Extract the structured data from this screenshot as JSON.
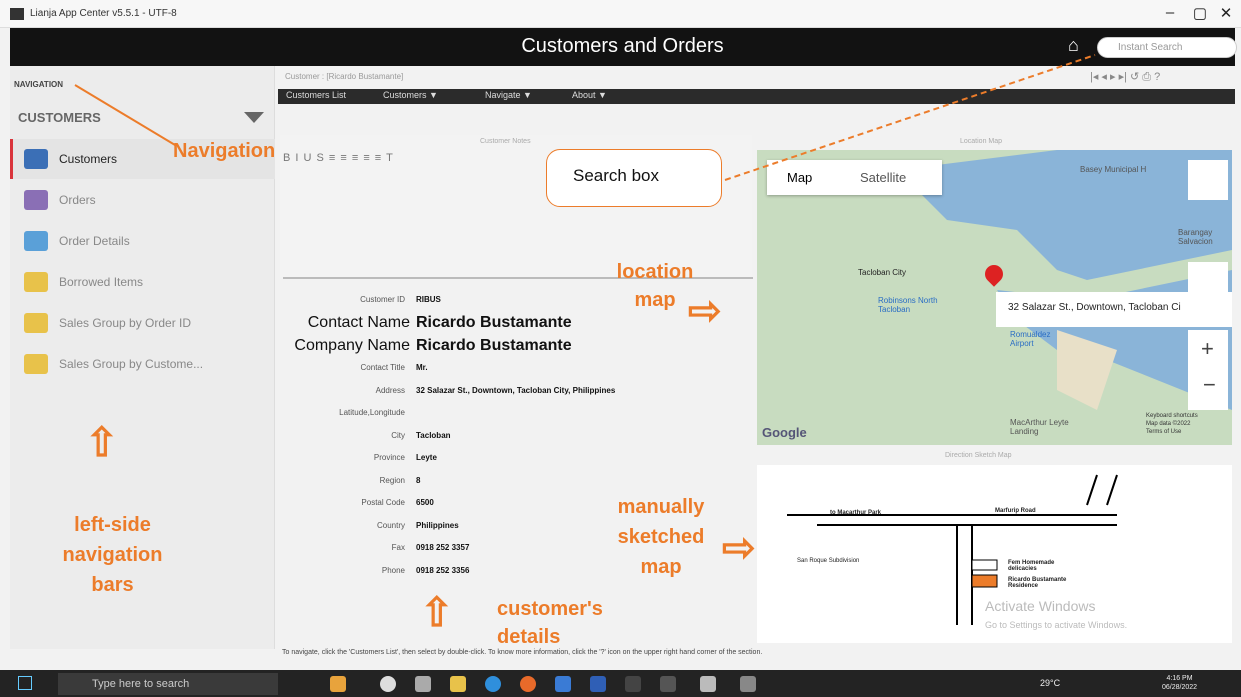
{
  "window": {
    "title": "Lianja App Center v5.5.1 - UTF-8",
    "minimize": "–",
    "maximize": "▢",
    "close": "✕"
  },
  "header": {
    "title": "Customers and Orders",
    "search_placeholder": "Instant Search"
  },
  "sidebar": {
    "navigation_label": "NAVIGATION",
    "section": "CUSTOMERS",
    "items": [
      {
        "label": "Customers",
        "icon": "customers-icon",
        "color": "#3b6fb6"
      },
      {
        "label": "Orders",
        "icon": "orders-icon",
        "color": "#8a6fb5"
      },
      {
        "label": "Order Details",
        "icon": "order-details-icon",
        "color": "#5aa0d8"
      },
      {
        "label": "Borrowed Items",
        "icon": "borrowed-items-icon",
        "color": "#e8c24a"
      },
      {
        "label": "Sales Group by Order ID",
        "icon": "sales-group-icon",
        "color": "#e8c24a"
      },
      {
        "label": "Sales Group by Custome...",
        "icon": "sales-group-customer-icon",
        "color": "#e8c24a"
      }
    ]
  },
  "main": {
    "breadcrumb": "Customer : [Ricardo Bustamante]",
    "pager": "|◂ ◂ ▸ ▸| ↺ ⎙ ?",
    "menus": [
      "Customers List",
      "Customers ▼",
      "Navigate ▼",
      "About ▼"
    ],
    "notes_title": "Customer Notes",
    "toolbar": "B I U S ≡ ≡ ≡ ≡ ≡ T",
    "details": [
      {
        "label": "Customer ID",
        "value": "RIBUS",
        "big": false
      },
      {
        "label": "Contact Name",
        "value": "Ricardo Bustamante",
        "big": true
      },
      {
        "label": "Company Name",
        "value": "Ricardo Bustamante",
        "big": true
      },
      {
        "label": "Contact Title",
        "value": "Mr.",
        "big": false
      },
      {
        "label": "Address",
        "value": "32 Salazar St., Downtown, Tacloban City, Philippines",
        "big": false
      },
      {
        "label": "Latitude,Longitude",
        "value": "",
        "big": false
      },
      {
        "label": "City",
        "value": "Tacloban",
        "big": false
      },
      {
        "label": "Province",
        "value": "Leyte",
        "big": false
      },
      {
        "label": "Region",
        "value": "8",
        "big": false
      },
      {
        "label": "Postal Code",
        "value": "6500",
        "big": false
      },
      {
        "label": "Country",
        "value": "Philippines",
        "big": false
      },
      {
        "label": "Fax",
        "value": "0918 252 3357",
        "big": false
      },
      {
        "label": "Phone",
        "value": "0918 252 3356",
        "big": false
      }
    ],
    "hint": "To navigate, click the 'Customers List', then select by double-click. To know more information, click the '?' icon on the upper right hand corner of the section."
  },
  "map": {
    "title": "Location Map",
    "tab_map": "Map",
    "tab_satellite": "Satellite",
    "address": "32 Salazar St., Downtown, Tacloban Ci",
    "labels": [
      "Tacloban City",
      "Robinsons North Tacloban",
      "Basey Municipal H",
      "Barangay Salvacion",
      "MacArthur Leyte Landing",
      "Romualdez Airport"
    ],
    "google": "Google",
    "attribution": [
      "Keyboard shortcuts",
      "Map data ©2022",
      "Terms of Use"
    ],
    "zoom_in": "+",
    "zoom_out": "−"
  },
  "sketch": {
    "title": "Direction Sketch Map",
    "labels": [
      "to Macarthur Park",
      "Marfurip Road",
      "San Roque Subdivision",
      "Fem Homemade delicacies",
      "Ricardo Bustamante Residence"
    ]
  },
  "watermark": {
    "line1": "Activate Windows",
    "line2": "Go to Settings to activate Windows."
  },
  "annotations": {
    "navigation": "Navigation",
    "search_box": "Search box",
    "location_map": "location map",
    "left_side": "left-side navigation bars",
    "manually": "manually sketched map",
    "customer_details": "customer's details"
  },
  "taskbar": {
    "search": "Type here to search",
    "temp": "29°C",
    "time": "4:16 PM",
    "date": "06/28/2022"
  }
}
